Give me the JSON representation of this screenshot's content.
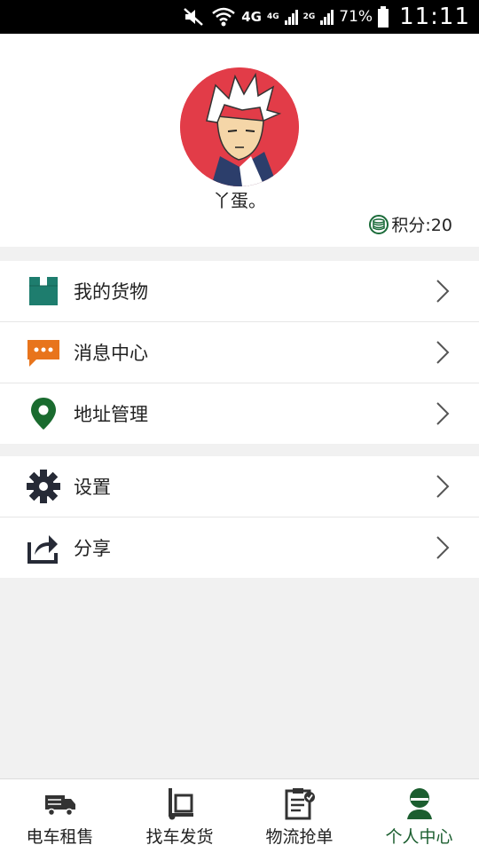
{
  "status_bar": {
    "network_4g": "4G",
    "sim1": "4G",
    "sim2": "2G",
    "battery": "71%",
    "time": "11:11"
  },
  "profile": {
    "username": "丫蛋。",
    "points_label": "积分:20",
    "avatar_bg": "#e23c48"
  },
  "menu_group_1": [
    {
      "label": "我的货物",
      "icon": "package-icon",
      "color": "#1e7d6e"
    },
    {
      "label": "消息中心",
      "icon": "message-icon",
      "color": "#e8741c"
    },
    {
      "label": "地址管理",
      "icon": "location-pin-icon",
      "color": "#1a6b2f"
    }
  ],
  "menu_group_2": [
    {
      "label": "设置",
      "icon": "gear-icon",
      "color": "#262a36"
    },
    {
      "label": "分享",
      "icon": "share-icon",
      "color": "#262a36"
    }
  ],
  "bottom_nav": [
    {
      "label": "电车租售",
      "icon": "truck-icon",
      "active": false
    },
    {
      "label": "找车发货",
      "icon": "hand-truck-icon",
      "active": false
    },
    {
      "label": "物流抢单",
      "icon": "clipboard-icon",
      "active": false
    },
    {
      "label": "个人中心",
      "icon": "person-icon",
      "active": true
    }
  ],
  "colors": {
    "active_tab": "#1b5e2f",
    "background": "#f1f1f1"
  }
}
